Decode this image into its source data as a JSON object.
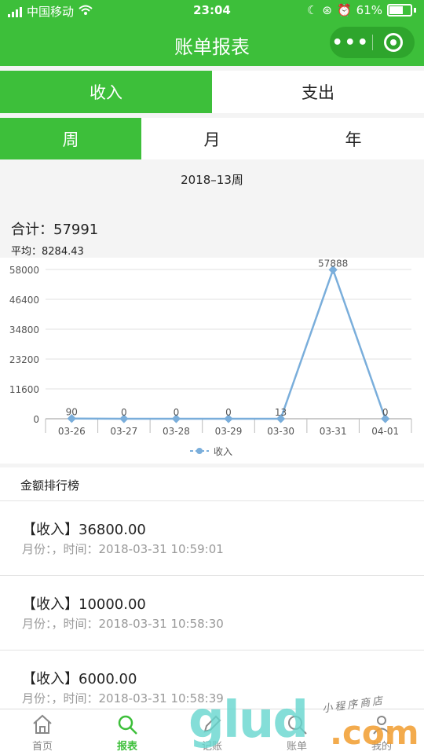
{
  "status": {
    "carrier": "中国移动",
    "time": "23:04",
    "battery": "61%"
  },
  "nav": {
    "title": "账单报表",
    "more_icon": "more-dots-icon",
    "close_icon": "close-target-icon"
  },
  "type_tabs": [
    {
      "label": "收入",
      "active": true
    },
    {
      "label": "支出",
      "active": false
    }
  ],
  "period_tabs": [
    {
      "label": "周",
      "active": true
    },
    {
      "label": "月",
      "active": false
    },
    {
      "label": "年",
      "active": false
    }
  ],
  "period_label": "2018–13周",
  "summary": {
    "total": "合计：57991",
    "average": "平均：8284.43"
  },
  "chart_data": {
    "type": "line",
    "categories": [
      "03-26",
      "03-27",
      "03-28",
      "03-29",
      "03-30",
      "03-31",
      "04-01"
    ],
    "series": [
      {
        "name": "收入",
        "values": [
          90,
          0,
          0,
          0,
          13,
          57888,
          0
        ],
        "color": "#7aaedb"
      }
    ],
    "yticks": [
      0,
      11600,
      23200,
      34800,
      46400,
      58000
    ],
    "ylim": [
      0,
      58000
    ],
    "data_labels": [
      "90",
      "0",
      "0",
      "0",
      "13",
      "57888",
      "0"
    ],
    "legend": "收入",
    "grid": true
  },
  "ranking": {
    "title": "金额排行榜",
    "items": [
      {
        "amount": "【收入】36800.00",
        "meta": "月份：，时间：2018-03-31 10:59:01"
      },
      {
        "amount": "【收入】10000.00",
        "meta": "月份：，时间：2018-03-31 10:58:30"
      },
      {
        "amount": "【收入】6000.00",
        "meta": "月份：，时间：2018-03-31 10:58:39"
      }
    ]
  },
  "tabbar": [
    {
      "label": "首页",
      "icon": "home-icon",
      "active": false
    },
    {
      "label": "报表",
      "icon": "search-icon",
      "active": true
    },
    {
      "label": "记账",
      "icon": "edit-icon",
      "active": false
    },
    {
      "label": "账单",
      "icon": "bill-icon",
      "active": false
    },
    {
      "label": "我的",
      "icon": "user-icon",
      "active": false
    }
  ],
  "watermark": {
    "text": "glud",
    "dot": ".com",
    "small": "小程序商店"
  },
  "colors": {
    "brand": "#3dbf3a",
    "line": "#7aaedb"
  }
}
